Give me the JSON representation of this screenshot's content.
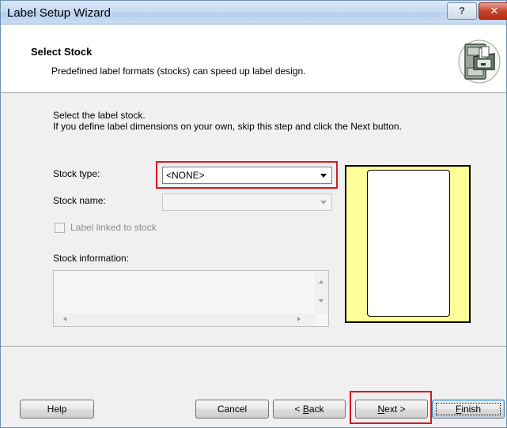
{
  "window": {
    "title": "Label Setup Wizard",
    "help_glyph": "?",
    "close_glyph": "✕"
  },
  "header": {
    "title": "Select Stock",
    "subtitle": "Predefined label formats (stocks) can speed up label design.",
    "icon": "file-cabinet-icon"
  },
  "intro": {
    "line1": "Select the label stock.",
    "line2": "If you define label dimensions on your own, skip this step and click the Next button."
  },
  "form": {
    "stock_type_label": "Stock type:",
    "stock_type_value": "<NONE>",
    "stock_name_label": "Stock name:",
    "stock_name_value": "",
    "linked_label": "Label linked to stock",
    "linked_checked": false,
    "info_label": "Stock information:",
    "info_value": ""
  },
  "buttons": {
    "help": "Help",
    "cancel": "Cancel",
    "back_prefix": "< ",
    "back_mnemonic": "B",
    "back_rest": "ack",
    "next_mnemonic": "N",
    "next_rest": "ext >",
    "finish_mnemonic": "F",
    "finish_rest": "inish"
  },
  "colors": {
    "highlight": "#d71920",
    "preview_background": "#ffff99"
  }
}
